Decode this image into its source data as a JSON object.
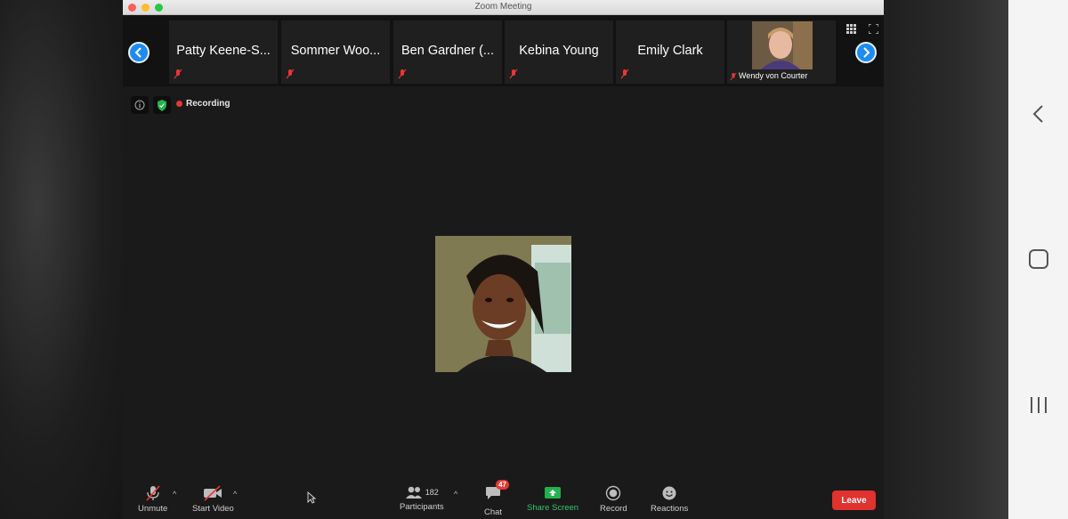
{
  "window": {
    "title": "Zoom Meeting"
  },
  "gallery": {
    "tiles": [
      {
        "name": "Patty Keene-S..."
      },
      {
        "name": "Sommer Woo..."
      },
      {
        "name": "Ben Gardner (..."
      },
      {
        "name": "Kebina Young"
      },
      {
        "name": "Emily Clark"
      }
    ],
    "video_tile": {
      "name": "Wendy von Courter"
    }
  },
  "status": {
    "recording_label": "Recording"
  },
  "toolbar": {
    "unmute_label": "Unmute",
    "start_video_label": "Start Video",
    "participants_label": "Participants",
    "participants_count": "182",
    "chat_label": "Chat",
    "chat_badge": "47",
    "share_screen_label": "Share Screen",
    "record_label": "Record",
    "reactions_label": "Reactions",
    "leave_label": "Leave"
  },
  "colors": {
    "accent_blue": "#1d8cf0",
    "share_green": "#33c46d",
    "leave_red": "#e0322e",
    "muted_red": "#e53935"
  }
}
